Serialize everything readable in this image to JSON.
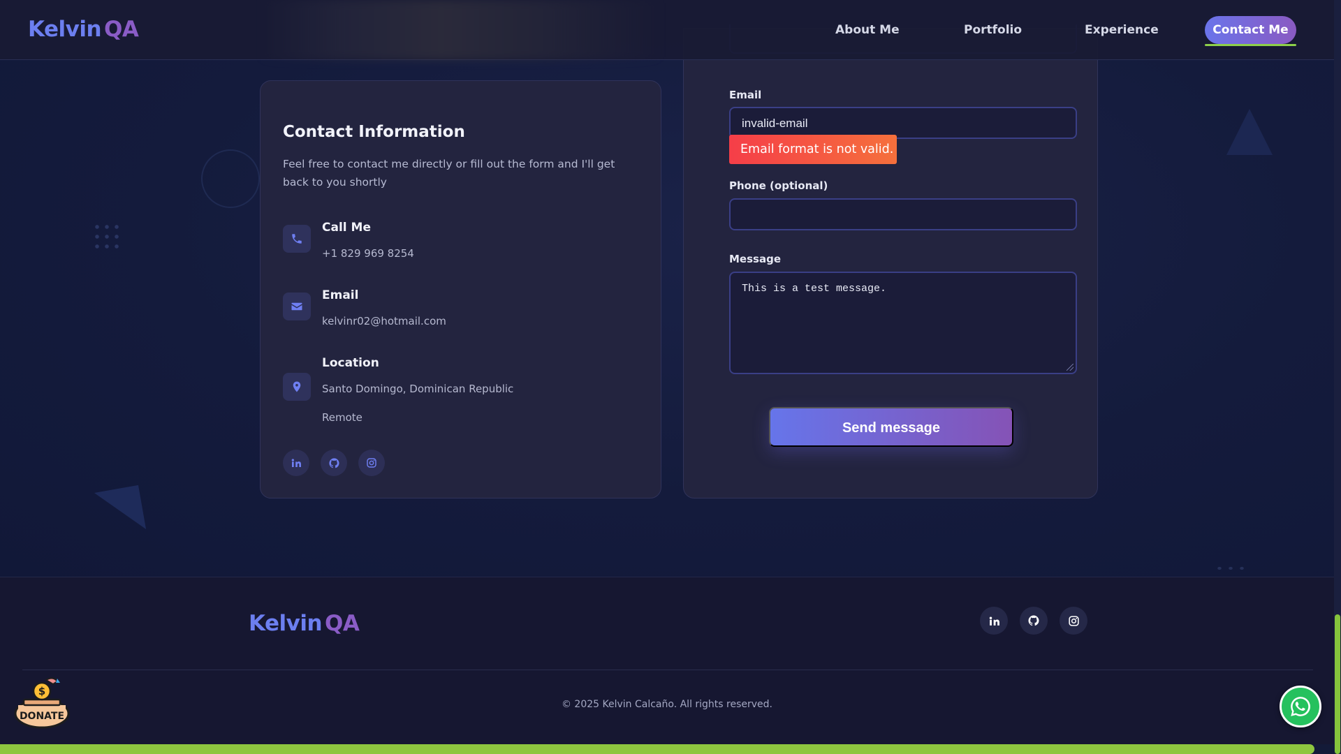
{
  "brand": {
    "first": "Kelvin",
    "second": "QA"
  },
  "nav": {
    "items": [
      {
        "label": "About Me"
      },
      {
        "label": "Portfolio"
      },
      {
        "label": "Experience"
      }
    ],
    "cta": "Contact Me"
  },
  "contact_info": {
    "title": "Contact Information",
    "description": "Feel free to contact me directly or fill out the form and I'll get back to you shortly",
    "items": [
      {
        "title": "Call Me",
        "values": [
          "+1 829 969 8254"
        ],
        "icon": "phone-icon"
      },
      {
        "title": "Email",
        "values": [
          "kelvinr02@hotmail.com"
        ],
        "icon": "envelope-icon"
      },
      {
        "title": "Location",
        "values": [
          "Santo Domingo, Dominican Republic",
          "Remote"
        ],
        "icon": "map-pin-icon"
      }
    ],
    "socials": [
      "linkedin-icon",
      "github-icon",
      "instagram-icon"
    ]
  },
  "form": {
    "email_label": "Email",
    "email_value": "invalid-email",
    "email_error": "Email format is not valid.",
    "phone_label": "Phone (optional)",
    "phone_value": "",
    "message_label": "Message",
    "message_value": "This is a test message.",
    "submit_label": "Send message"
  },
  "footer": {
    "socials": [
      "linkedin-icon",
      "github-icon",
      "instagram-icon"
    ],
    "copyright": "© 2025 Kelvin Calcaño. All rights reserved."
  },
  "widgets": {
    "donate_label": "DONATE",
    "whatsapp": "whatsapp-icon"
  },
  "page_scroll_progress": 0.98,
  "colors": {
    "accent": "#6a74ea",
    "accent_2": "#8a5ac2",
    "error": "#f53e48",
    "progress": "#8ec63f",
    "whatsapp": "#25c15e"
  }
}
